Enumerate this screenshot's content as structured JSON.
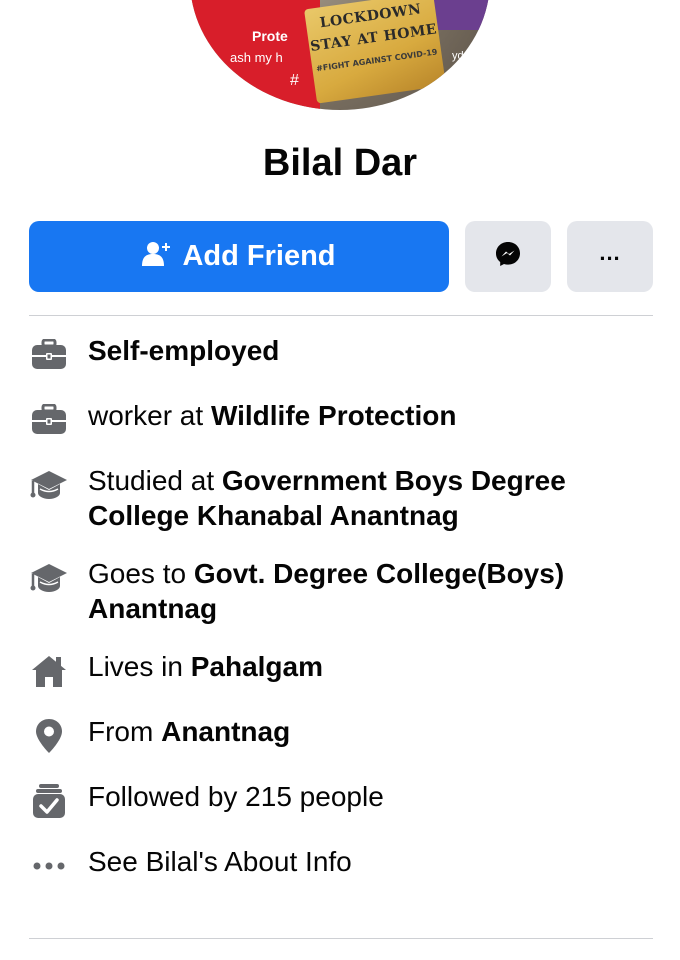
{
  "profile": {
    "name": "Bilal Dar",
    "avatar": {
      "texts": [
        "Prote",
        "ash my h",
        "#",
        "LOCKDOWN",
        "STAY AT HOME",
        "#FIGHT AGAINST COVID-19",
        "yd"
      ]
    }
  },
  "actions": {
    "add_friend_label": "Add Friend",
    "messenger_icon": "messenger-icon",
    "more_label": "..."
  },
  "intro": {
    "items": [
      {
        "icon": "briefcase-icon",
        "prefix": "",
        "bold": "Self-employed"
      },
      {
        "icon": "briefcase-icon",
        "prefix": "worker at ",
        "bold": "Wildlife Protection"
      },
      {
        "icon": "graduation-cap-icon",
        "prefix": "Studied at ",
        "bold": "Government Boys Degree College Khanabal Anantnag"
      },
      {
        "icon": "graduation-cap-icon",
        "prefix": "Goes to ",
        "bold": "Govt. Degree College(Boys) Anantnag"
      },
      {
        "icon": "home-icon",
        "prefix": "Lives in ",
        "bold": "Pahalgam"
      },
      {
        "icon": "location-pin-icon",
        "prefix": "From ",
        "bold": "Anantnag"
      },
      {
        "icon": "followers-icon",
        "prefix": "Followed by 215 people",
        "bold": ""
      },
      {
        "icon": "more-dots-icon",
        "prefix": "See Bilal's About Info",
        "bold": ""
      }
    ]
  },
  "colors": {
    "accent": "#1877f2",
    "button_grey": "#e4e6eb",
    "icon_grey": "#65676b",
    "text": "#050505",
    "divider": "#ced0d4"
  }
}
